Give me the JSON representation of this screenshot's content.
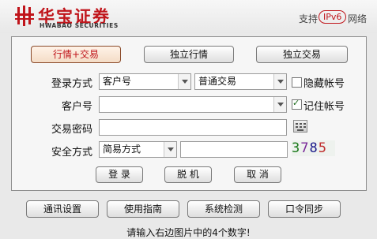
{
  "header": {
    "brand_cn": "华宝证券",
    "brand_en": "HWABAO SECURITIES",
    "support_label": "支持",
    "ipv6_label": "IPv6",
    "network_label": "网络"
  },
  "mode_tabs": [
    {
      "label": "行情+交易",
      "active": true
    },
    {
      "label": "独立行情",
      "active": false
    },
    {
      "label": "独立交易",
      "active": false
    }
  ],
  "form": {
    "login_type_label": "登录方式",
    "login_type_value": "客户号",
    "trade_type_value": "普通交易",
    "hide_account_label": "隐藏帐号",
    "hide_account_checked": false,
    "account_label": "客户号",
    "account_value": "",
    "remember_label": "记住帐号",
    "remember_checked": true,
    "password_label": "交易密码",
    "password_value": "",
    "security_label": "安全方式",
    "security_value": "简易方式",
    "verify_value": "",
    "captcha_digits": [
      "3",
      "7",
      "8",
      "5"
    ],
    "captcha_colors": [
      "#1a7a1a",
      "#7a2a9a",
      "#1a1a8a",
      "#c03030"
    ]
  },
  "actions": {
    "login": "登 录",
    "offline": "脱 机",
    "cancel": "取 消"
  },
  "footer_buttons": [
    "通讯设置",
    "使用指南",
    "系统检测",
    "口令同步"
  ],
  "hint": "请输入右边图片中的4个数字!"
}
